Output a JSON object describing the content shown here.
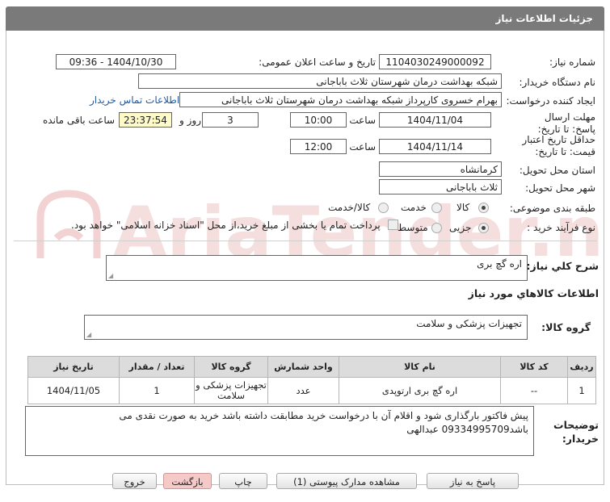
{
  "header_title": "جزئیات اطلاعات نیاز",
  "watermark_text": "AriaTender.net",
  "labels": {
    "need_number": "شماره نیاز:",
    "announce": "تاریخ و ساعت اعلان عمومی:",
    "buyer_org": "نام دستگاه خریدار:",
    "creator": "ایجاد کننده درخواست:",
    "reply_deadline": "مهلت ارسال پاسخ: تا تاریخ:",
    "time": "ساعت",
    "day_and": "روز و",
    "remaining": "ساعت باقی مانده",
    "validity": "حداقل تاریخ اعتبار قیمت: تا تاریخ:",
    "time2": "ساعت",
    "province": "استان محل تحویل:",
    "city": "شهر محل تحویل:",
    "category": "طبقه بندی موضوعی:",
    "cat_goods": "کالا",
    "cat_service": "خدمت",
    "cat_goods_service": "کالا/خدمت",
    "process_type": "نوع فرآیند خرید :",
    "proc_small": "جزیی",
    "proc_medium": "متوسط",
    "payment_note": "پرداخت تمام یا بخشی از مبلغ خرید،از محل \"اسناد خزانه اسلامی\" خواهد بود.",
    "general_desc": "شرح کلي نیاز:",
    "goods_info": "اطلاعات کالاهاي مورد نیاز",
    "goods_group": "گروه کالا:",
    "buyer_notes": "توضیحات خریدار:"
  },
  "values": {
    "need_number": "1104030249000092",
    "announce_datetime": "1404/10/30 - 09:36",
    "buyer_org": "شبکه بهداشت درمان شهرستان ثلاث باباجانی",
    "creator": "بهرام خسروی کارپرداز شبکه بهداشت درمان شهرستان ثلاث باباجانی",
    "contact_link": "اطلاعات تماس خریدار",
    "reply_date": "1404/11/04",
    "reply_time": "10:00",
    "days": "3",
    "remaining_time": "23:37:54",
    "validity_date": "1404/11/14",
    "validity_time": "12:00",
    "province": "کرمانشاه",
    "city": "ثلاث باباجانی",
    "general_desc": "اره گچ بری",
    "goods_group": "تجهیزات پزشکی و سلامت",
    "buyer_notes": "پیش فاکتور بارگذاری شود و اقلام آن با درخواست خرید مطابقت داشته باشد خرید به صورت نقدی می باشد09334995709 عبدالهی"
  },
  "table": {
    "headers": [
      "ردیف",
      "کد کالا",
      "نام کالا",
      "واحد شمارش",
      "گروه کالا",
      "تعداد / مقدار",
      "تاریخ نیاز"
    ],
    "rows": [
      [
        "1",
        "--",
        "اره گچ بری ارتوپدی",
        "عدد",
        "تجهیزات پزشکی و سلامت",
        "1",
        "1404/11/05"
      ]
    ]
  },
  "buttons": {
    "reply": "پاسخ به نیاز",
    "attachments": "مشاهده مدارک پیوستی (1)",
    "print": "چاپ",
    "back": "بازگشت",
    "exit": "خروج"
  }
}
